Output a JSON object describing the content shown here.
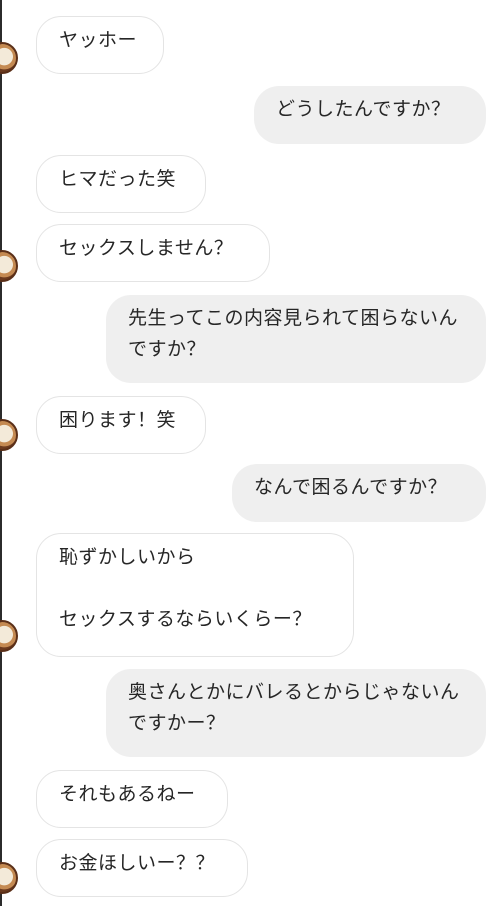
{
  "messages": [
    {
      "text": "ヤッホー",
      "direction": "incoming"
    },
    {
      "text": "どうしたんですか？",
      "direction": "outgoing"
    },
    {
      "text": "ヒマだった笑",
      "direction": "incoming"
    },
    {
      "text": "セックスしません？",
      "direction": "incoming"
    },
    {
      "text": "先生ってこの内容見られて困らないんですか？",
      "direction": "outgoing"
    },
    {
      "text": "困ります！笑",
      "direction": "incoming"
    },
    {
      "text": "なんで困るんですか？",
      "direction": "outgoing"
    },
    {
      "text": "恥ずかしいから\n\nセックスするならいくらー？",
      "direction": "incoming"
    },
    {
      "text": "奥さんとかにバレるとからじゃないんですかー？",
      "direction": "outgoing"
    },
    {
      "text": "それもあるねー",
      "direction": "incoming"
    },
    {
      "text": "お金ほしいー？？",
      "direction": "incoming"
    }
  ],
  "colors": {
    "incoming_bubble": "#ffffff",
    "incoming_border": "#e4e4e4",
    "outgoing_bubble": "#efefef",
    "text": "#262626"
  },
  "icons": {
    "avatar": "contact-avatar-icon"
  }
}
